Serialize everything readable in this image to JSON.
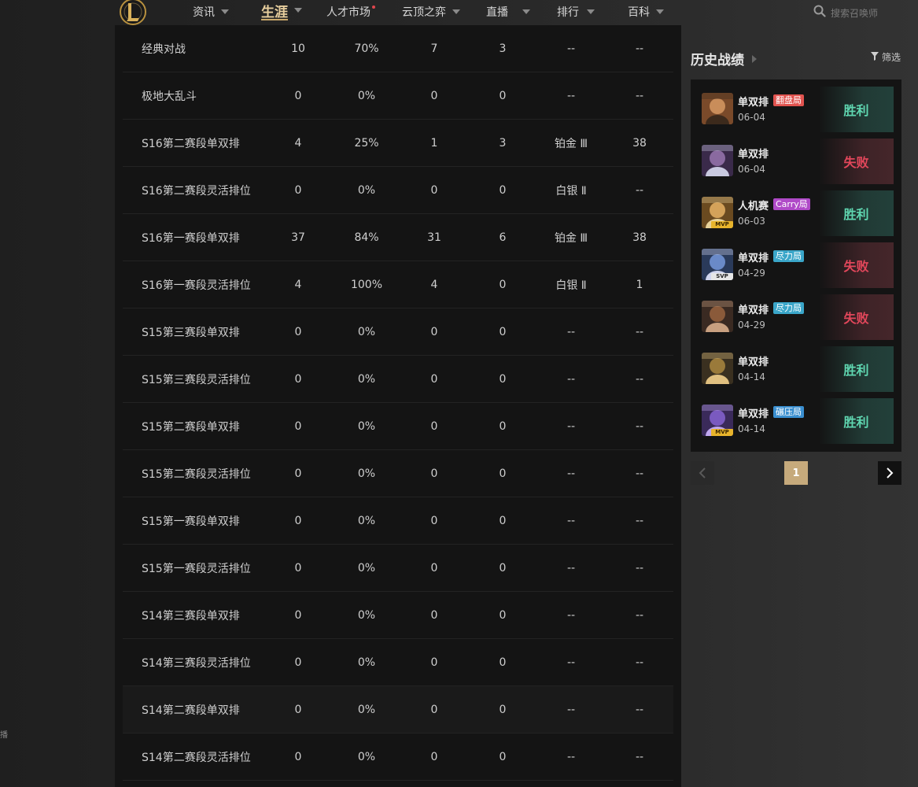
{
  "nav": {
    "items": [
      {
        "label": "资讯"
      },
      {
        "label": "生涯"
      },
      {
        "label": "人才市场"
      },
      {
        "label": "云顶之弈"
      },
      {
        "label": "直播"
      },
      {
        "label": "排行"
      },
      {
        "label": "百科"
      }
    ],
    "search_placeholder": "搜索召唤师",
    "left_edge_glyph": "播"
  },
  "season_table": {
    "rows": [
      {
        "name": "经典对战",
        "games": "10",
        "winrate": "70%",
        "wins": "7",
        "losses": "3",
        "rank": "--",
        "points": "--"
      },
      {
        "name": "极地大乱斗",
        "games": "0",
        "winrate": "0%",
        "wins": "0",
        "losses": "0",
        "rank": "--",
        "points": "--"
      },
      {
        "name": "S16第二赛段单双排",
        "games": "4",
        "winrate": "25%",
        "wins": "1",
        "losses": "3",
        "rank": "铂金 Ⅲ",
        "points": "38"
      },
      {
        "name": "S16第二赛段灵活排位",
        "games": "0",
        "winrate": "0%",
        "wins": "0",
        "losses": "0",
        "rank": "白银 Ⅱ",
        "points": "--"
      },
      {
        "name": "S16第一赛段单双排",
        "games": "37",
        "winrate": "84%",
        "wins": "31",
        "losses": "6",
        "rank": "铂金 Ⅲ",
        "points": "38"
      },
      {
        "name": "S16第一赛段灵活排位",
        "games": "4",
        "winrate": "100%",
        "wins": "4",
        "losses": "0",
        "rank": "白银 Ⅱ",
        "points": "1"
      },
      {
        "name": "S15第三赛段单双排",
        "games": "0",
        "winrate": "0%",
        "wins": "0",
        "losses": "0",
        "rank": "--",
        "points": "--"
      },
      {
        "name": "S15第三赛段灵活排位",
        "games": "0",
        "winrate": "0%",
        "wins": "0",
        "losses": "0",
        "rank": "--",
        "points": "--"
      },
      {
        "name": "S15第二赛段单双排",
        "games": "0",
        "winrate": "0%",
        "wins": "0",
        "losses": "0",
        "rank": "--",
        "points": "--"
      },
      {
        "name": "S15第二赛段灵活排位",
        "games": "0",
        "winrate": "0%",
        "wins": "0",
        "losses": "0",
        "rank": "--",
        "points": "--"
      },
      {
        "name": "S15第一赛段单双排",
        "games": "0",
        "winrate": "0%",
        "wins": "0",
        "losses": "0",
        "rank": "--",
        "points": "--"
      },
      {
        "name": "S15第一赛段灵活排位",
        "games": "0",
        "winrate": "0%",
        "wins": "0",
        "losses": "0",
        "rank": "--",
        "points": "--"
      },
      {
        "name": "S14第三赛段单双排",
        "games": "0",
        "winrate": "0%",
        "wins": "0",
        "losses": "0",
        "rank": "--",
        "points": "--"
      },
      {
        "name": "S14第三赛段灵活排位",
        "games": "0",
        "winrate": "0%",
        "wins": "0",
        "losses": "0",
        "rank": "--",
        "points": "--"
      },
      {
        "name": "S14第二赛段单双排",
        "games": "0",
        "winrate": "0%",
        "wins": "0",
        "losses": "0",
        "rank": "--",
        "points": "--"
      },
      {
        "name": "S14第二赛段灵活排位",
        "games": "0",
        "winrate": "0%",
        "wins": "0",
        "losses": "0",
        "rank": "--",
        "points": "--"
      }
    ]
  },
  "history": {
    "title": "历史战绩",
    "filter_label": "筛选",
    "matches": [
      {
        "mode": "单双排",
        "tag": "翻盘局",
        "date": "06-04",
        "result": "胜利",
        "badge": ""
      },
      {
        "mode": "单双排",
        "tag": "",
        "date": "06-04",
        "result": "失败",
        "badge": ""
      },
      {
        "mode": "人机赛",
        "tag": "Carry局",
        "date": "06-03",
        "result": "胜利",
        "badge": "MVP"
      },
      {
        "mode": "单双排",
        "tag": "尽力局",
        "date": "04-29",
        "result": "失败",
        "badge": "SVP"
      },
      {
        "mode": "单双排",
        "tag": "尽力局",
        "date": "04-29",
        "result": "失败",
        "badge": ""
      },
      {
        "mode": "单双排",
        "tag": "",
        "date": "04-14",
        "result": "胜利",
        "badge": ""
      },
      {
        "mode": "单双排",
        "tag": "碾压局",
        "date": "04-14",
        "result": "胜利",
        "badge": "MVP"
      }
    ],
    "pagination": {
      "current_page": "1"
    }
  },
  "colors": {
    "accent_gold": "#c9a86a",
    "win": "#5fd6b0",
    "lose": "#e2475b",
    "tag_comeback": "#e1534f",
    "tag_carry": "#b04ac8",
    "tag_tried": "#3aa6c9",
    "tag_crush": "#3a8fd0"
  }
}
